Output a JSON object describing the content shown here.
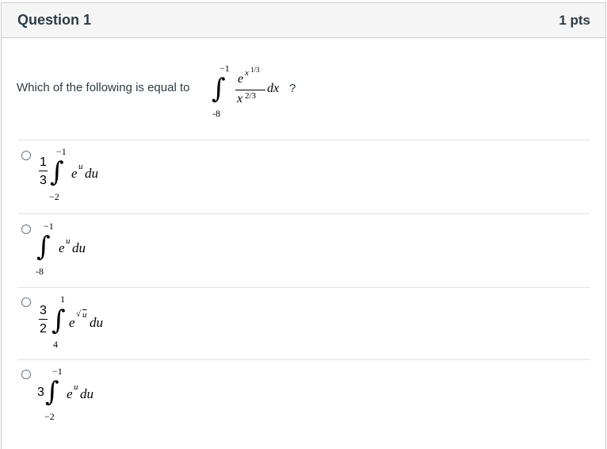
{
  "question": {
    "title": "Question 1",
    "points": "1 pts",
    "prompt_text": "Which of the following is equal to",
    "prompt_end": "?",
    "integral": {
      "upper": "−1",
      "lower": "-8",
      "numerator_base": "e",
      "numerator_exp": "x",
      "numerator_exp_power": "1/3",
      "denominator_base": "x",
      "denominator_power": "2/3",
      "differential": "dx"
    }
  },
  "answers": [
    {
      "coef_num": "1",
      "coef_den": "3",
      "upper": "−1",
      "lower": "−2",
      "integrand_base": "e",
      "integrand_exp": "u",
      "differential": "du"
    },
    {
      "upper": "−1",
      "lower": "-8",
      "integrand_base": "e",
      "integrand_exp": "u",
      "differential": "du"
    },
    {
      "coef_num": "3",
      "coef_den": "2",
      "upper": "1",
      "lower": "4",
      "integrand_base": "e",
      "integrand_exp_sqrt": "u",
      "differential": "du"
    },
    {
      "coef": "3",
      "upper": "−1",
      "lower": "−2",
      "integrand_base": "e",
      "integrand_exp": "u",
      "differential": "du"
    }
  ]
}
